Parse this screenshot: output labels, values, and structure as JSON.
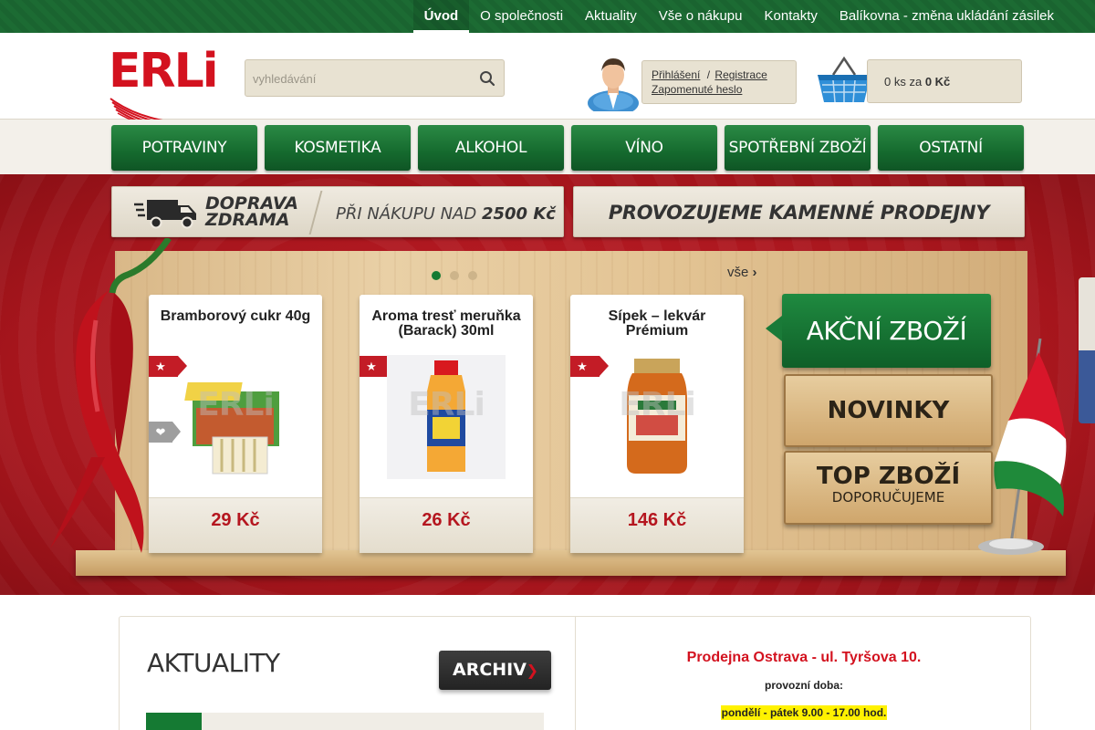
{
  "topnav": [
    {
      "label": "Úvod"
    },
    {
      "label": "O společnosti"
    },
    {
      "label": "Aktuality"
    },
    {
      "label": "Vše o nákupu"
    },
    {
      "label": "Kontakty"
    },
    {
      "label": "Balíkovna - změna ukládání zásilek"
    }
  ],
  "logo": {
    "text": "ERLi"
  },
  "search": {
    "placeholder": "vyhledávání"
  },
  "login": {
    "login_label": "Přihlášení",
    "separator": "/",
    "register_label": "Registrace",
    "forgot_label": "Zapomenuté heslo"
  },
  "cart": {
    "count_text": "0 ks za",
    "total": "0 Kč"
  },
  "categories": [
    {
      "label": "POTRAVINY"
    },
    {
      "label": "KOSMETIKA"
    },
    {
      "label": "ALKOHOL"
    },
    {
      "label": "VÍNO"
    },
    {
      "label": "SPOTŘEBNÍ ZBOŽÍ"
    },
    {
      "label": "OSTATNÍ"
    }
  ],
  "banners": {
    "delivery_line1": "DOPRAVA",
    "delivery_line2": "ZDRAMA",
    "delivery_condition": "PŘI NÁKUPU NAD",
    "delivery_amount": "2500 Kč",
    "stores": "PROVOZUJEME KAMENNÉ PRODEJNY"
  },
  "slider": {
    "all_label": "vše",
    "all_arrow": "›",
    "pages": 3,
    "active_page": 1
  },
  "products": [
    {
      "title": "Bramborový cukr 40g",
      "price": "29 Kč",
      "watermark": "ERLi"
    },
    {
      "title": "Aroma tresť meruňka (Barack) 30ml",
      "price": "26 Kč",
      "watermark": "ERLi"
    },
    {
      "title": "Sípek – lekvár Prémium",
      "price": "146 Kč",
      "watermark": "ERLi"
    }
  ],
  "side_buttons": {
    "sale": "AKČNÍ ZBOŽÍ",
    "new": "NOVINKY",
    "top": "TOP ZBOŽÍ",
    "top_sub": "DOPORUČUJEME"
  },
  "news": {
    "title": "AKTUALITY",
    "archive_label": "ARCHIV",
    "archive_arrow": "❯"
  },
  "store": {
    "title": "Prodejna Ostrava - ul. Tyršova 10.",
    "hours_label": "provozní doba:",
    "hours": "pondělí - pátek 9.00 - 17.00 hod."
  },
  "colors": {
    "brand_red": "#d3121f",
    "brand_green": "#157a33",
    "price_red": "#b5161f"
  }
}
